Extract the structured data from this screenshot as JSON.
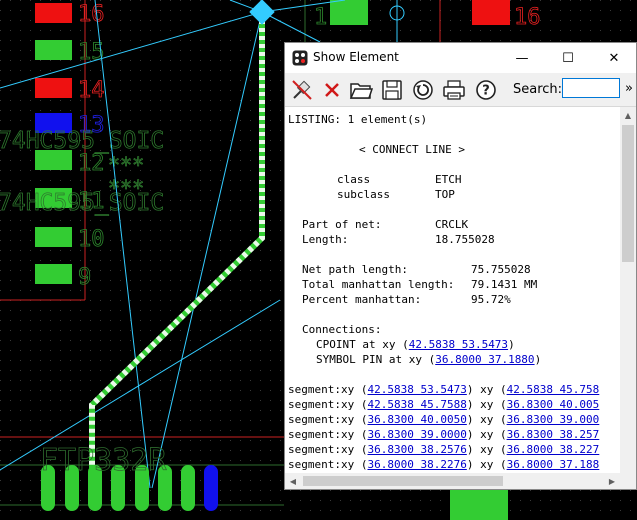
{
  "pcb": {
    "pins_left": [
      "16",
      "15",
      "14",
      "13",
      "12",
      "11",
      "10",
      "9"
    ],
    "pins_top": [
      "1"
    ],
    "pins_right": [
      "16"
    ],
    "refdes_overlay": [
      "74HC595_SOIC",
      "74HC595_SOIC"
    ],
    "asterisks": [
      "***",
      "***"
    ],
    "bottom_label": "FTP332R"
  },
  "window": {
    "title": "Show Element",
    "minimize": "—",
    "maximize": "☐",
    "close": "✕"
  },
  "toolbar": {
    "buttons": [
      "pin-icon",
      "delete-icon",
      "open-folder-icon",
      "save-icon",
      "refresh-icon",
      "print-icon",
      "help-icon"
    ],
    "search_label": "Search:",
    "search_value": "",
    "more": "»"
  },
  "report": {
    "header": "LISTING: 1 element(s)",
    "type": "< CONNECT LINE >",
    "class_label": "class",
    "class_value": "ETCH",
    "subclass_label": "subclass",
    "subclass_value": "TOP",
    "part_of_net_label": "Part of net:",
    "part_of_net_value": "CRCLK",
    "length_label": "Length:",
    "length_value": "18.755028",
    "net_path_label": "Net path length:",
    "net_path_value": "75.755028",
    "manhattan_label": "Total manhattan length:",
    "manhattan_value": "79.1431 MM",
    "percent_label": "Percent manhattan:",
    "percent_value": "95.72%",
    "connections_label": "Connections:",
    "cpoint_prefix": "CPOINT at xy (",
    "cpoint_link": "42.5838 53.5473",
    "suffix": ")",
    "symbol_prefix": "SYMBOL PIN at xy (",
    "symbol_link": "36.8000 37.1880",
    "segment_prefix": "segment:xy (",
    "xy_mid": ") xy (",
    "segments": [
      {
        "a": "42.5838 53.5473",
        "b": "42.5838 45.758"
      },
      {
        "a": "42.5838 45.7588",
        "b": "36.8300 40.005"
      },
      {
        "a": "36.8300 40.0050",
        "b": "36.8300 39.000"
      },
      {
        "a": "36.8300 39.0000",
        "b": "36.8300 38.257"
      },
      {
        "a": "36.8300 38.2576",
        "b": "36.8000 38.227"
      },
      {
        "a": "36.8000 38.2276",
        "b": "36.8000 37.188"
      }
    ]
  },
  "colors": {
    "pad_green": "#33cc33",
    "pad_red": "#ee1111",
    "pad_blue": "#1111ee",
    "ratsnest": "#33ccff",
    "silkscreen": "#2e6b2e",
    "board_edge": "#cc2222"
  }
}
